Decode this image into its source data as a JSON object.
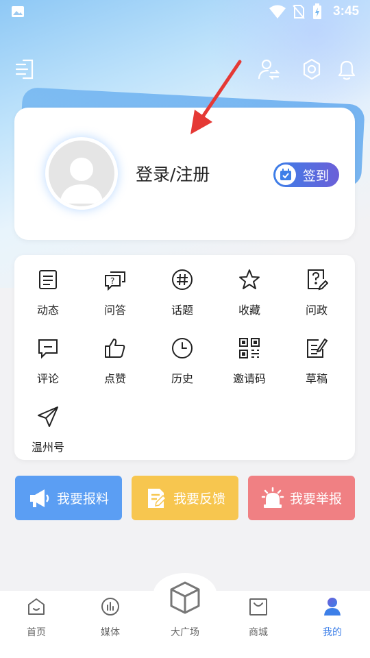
{
  "status_bar": {
    "time": "3:45"
  },
  "profile": {
    "login_label": "登录/注册",
    "signin_label": "签到"
  },
  "grid": [
    {
      "label": "动态",
      "icon": "feed-icon"
    },
    {
      "label": "问答",
      "icon": "qa-icon"
    },
    {
      "label": "话题",
      "icon": "hashtag-icon"
    },
    {
      "label": "收藏",
      "icon": "star-icon"
    },
    {
      "label": "问政",
      "icon": "question-pen-icon"
    },
    {
      "label": "评论",
      "icon": "comment-icon"
    },
    {
      "label": "点赞",
      "icon": "thumbs-up-icon"
    },
    {
      "label": "历史",
      "icon": "clock-icon"
    },
    {
      "label": "邀请码",
      "icon": "qr-code-icon"
    },
    {
      "label": "草稿",
      "icon": "draft-icon"
    },
    {
      "label": "温州号",
      "icon": "paper-plane-icon"
    }
  ],
  "actions": {
    "report": "我要报料",
    "feedback": "我要反馈",
    "complain": "我要举报"
  },
  "nav": {
    "home": "首页",
    "media": "媒体",
    "plaza": "大广场",
    "shop": "商城",
    "mine": "我的"
  },
  "colors": {
    "accent": "#3d7fe8",
    "report": "#5b9ef3",
    "feedback": "#f7c64f",
    "complain": "#f08083",
    "annotation_arrow": "#e53935"
  }
}
